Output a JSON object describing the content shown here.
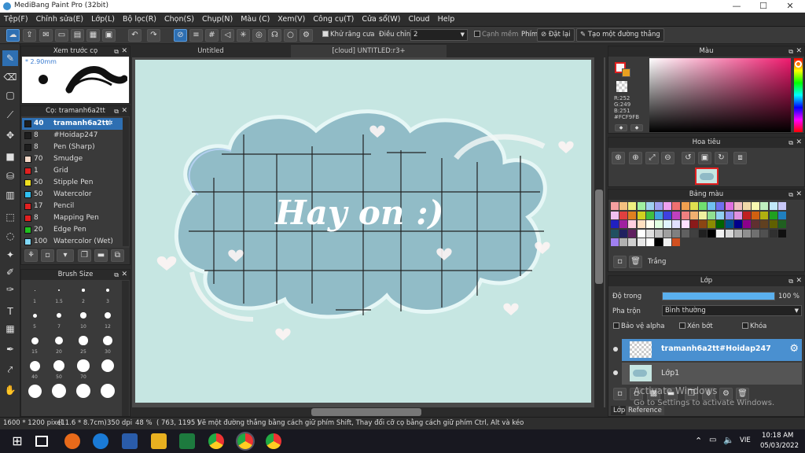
{
  "window": {
    "title": "MediBang Paint Pro (32bit)",
    "min": "—",
    "max": "☐",
    "close": "✕"
  },
  "menu": [
    "Tệp(F)",
    "Chỉnh sửa(E)",
    "Lớp(L)",
    "Bộ lọc(R)",
    "Chọn(S)",
    "Chụp(N)",
    "Màu (C)",
    "Xem(V)",
    "Công cụ(T)",
    "Cửa sổ(W)",
    "Cloud",
    "Help"
  ],
  "toolbar": {
    "antialias": "Khử răng cưa",
    "adjust_label": "Điều chỉnh",
    "adjust_value": "2",
    "edge": "Cạnh mềm",
    "key_label": "Phím",
    "reset": "Đặt lại",
    "straight": "Tạo một đường thẳng"
  },
  "preview": {
    "title": "Xem trước cọ",
    "size": "* 2.90mm"
  },
  "brush_panel": {
    "title": "Cọ: tramanh6a2tt",
    "brushes": [
      {
        "num": "40",
        "name": "tramanh6a2tt",
        "color": "#1e1e1e"
      },
      {
        "num": "8",
        "name": "#Hoidap247",
        "color": "#1e1e1e"
      },
      {
        "num": "8",
        "name": "Pen (Sharp)",
        "color": "#1e1e1e"
      },
      {
        "num": "70",
        "name": "Smudge",
        "color": "#f4d9c8"
      },
      {
        "num": "1",
        "name": "Grid",
        "color": "#e02020"
      },
      {
        "num": "50",
        "name": "Stipple Pen",
        "color": "#f0e020"
      },
      {
        "num": "50",
        "name": "Watercolor",
        "color": "#30c0f0"
      },
      {
        "num": "17",
        "name": "Pencil",
        "color": "#e02020"
      },
      {
        "num": "8",
        "name": "Mapping Pen",
        "color": "#e02020"
      },
      {
        "num": "20",
        "name": "Edge Pen",
        "color": "#20c020"
      },
      {
        "num": "100",
        "name": "Watercolor (Wet)",
        "color": "#80d8f8"
      }
    ]
  },
  "brush_size": {
    "title": "Brush Size",
    "sizes": [
      "1",
      "1.5",
      "2",
      "3",
      "5",
      "7",
      "10",
      "12",
      "15",
      "20",
      "25",
      "30",
      "40",
      "50",
      "70"
    ]
  },
  "tabs": [
    "Untitled",
    "[cloud] UNTITLED:r3+"
  ],
  "canvas_text": "Hay on :)",
  "color_panel": {
    "title": "Màu",
    "r": "R:252",
    "g": "G:249",
    "b": "B:251",
    "hex": "#FCF9FB",
    "fg": "#fcf9fb"
  },
  "navigator": {
    "title": "Hoa tiêu"
  },
  "palette": {
    "title": "Bảng màu",
    "label": "Trắng",
    "colors": [
      "#f5a0a0",
      "#f5c080",
      "#f0f080",
      "#a0f0a0",
      "#a0d0f0",
      "#a0a0f0",
      "#f0a0f0",
      "#f07070",
      "#f0a050",
      "#e0e050",
      "#70e070",
      "#70c0f0",
      "#7070f0",
      "#e070e0",
      "#f0c0c0",
      "#f0d8a8",
      "#f8f8b0",
      "#c0f0c0",
      "#c0e8f8",
      "#c8c8f8",
      "#f0c0f0",
      "#e04040",
      "#e08020",
      "#d0d020",
      "#40c040",
      "#40a0e0",
      "#4040e0",
      "#c040c0",
      "#f08080",
      "#f0b070",
      "#f0f0a0",
      "#90e090",
      "#90d0f0",
      "#9090f0",
      "#e090e0",
      "#c02020",
      "#d06010",
      "#b0b010",
      "#20a020",
      "#2080c0",
      "#2020c0",
      "#a020a0",
      "#ffd0e0",
      "#ffe0c0",
      "#fffff0",
      "#e0ffe0",
      "#e0f4ff",
      "#e0e0ff",
      "#ffe0ff",
      "#8b1a1a",
      "#8b4513",
      "#8b8b00",
      "#006400",
      "#00508b",
      "#00008b",
      "#8b008b",
      "#603030",
      "#604020",
      "#606000",
      "#206020",
      "#205060",
      "#202060",
      "#602060",
      "#ffffff",
      "#e0e0e0",
      "#c0c0c0",
      "#a0a0a0",
      "#808080",
      "#606060",
      "#404040",
      "#202020",
      "#000000",
      "#f0f0f0",
      "#d8d8d8",
      "#b0b0b0",
      "#909090",
      "#707070",
      "#505050",
      "#303030",
      "#101010",
      "#a080f0",
      "#b0b0b0",
      "#d0d0d0",
      "#e8e8e8",
      "#ffffff",
      "#000000",
      "#f0f0f0",
      "#d05020"
    ]
  },
  "layer_panel": {
    "title": "Lớp",
    "opacity_label": "Độ trong",
    "opacity_value": "100 %",
    "opacity_fraction": 1.0,
    "blend_label": "Pha trộn",
    "blend_value": "Bình thường",
    "protect_alpha": "Bảo vệ alpha",
    "clip": "Xén bớt",
    "lock": "Khóa",
    "layers": [
      "tramanh6a2tt#Hoidap247",
      "Lớp1"
    ],
    "tabs": [
      "Lớp",
      "Reference"
    ]
  },
  "status": {
    "size": "1600 * 1200 pixel",
    "cm": "(11.6 * 8.7cm)",
    "dpi": "350 dpi",
    "zoom": "48 %",
    "coords": "( 763, 1195 )",
    "hint": "Vẽ một đường thẳng bằng cách giữ phím Shift, Thay đổi cỡ cọ bằng cách giữ phím Ctrl, Alt và kéo"
  },
  "watermark": {
    "line1": "Activate Windows",
    "line2": "Go to Settings to activate Windows."
  },
  "taskbar": {
    "lang": "VIE",
    "time": "10:18 AM",
    "date": "05/03/2022"
  }
}
